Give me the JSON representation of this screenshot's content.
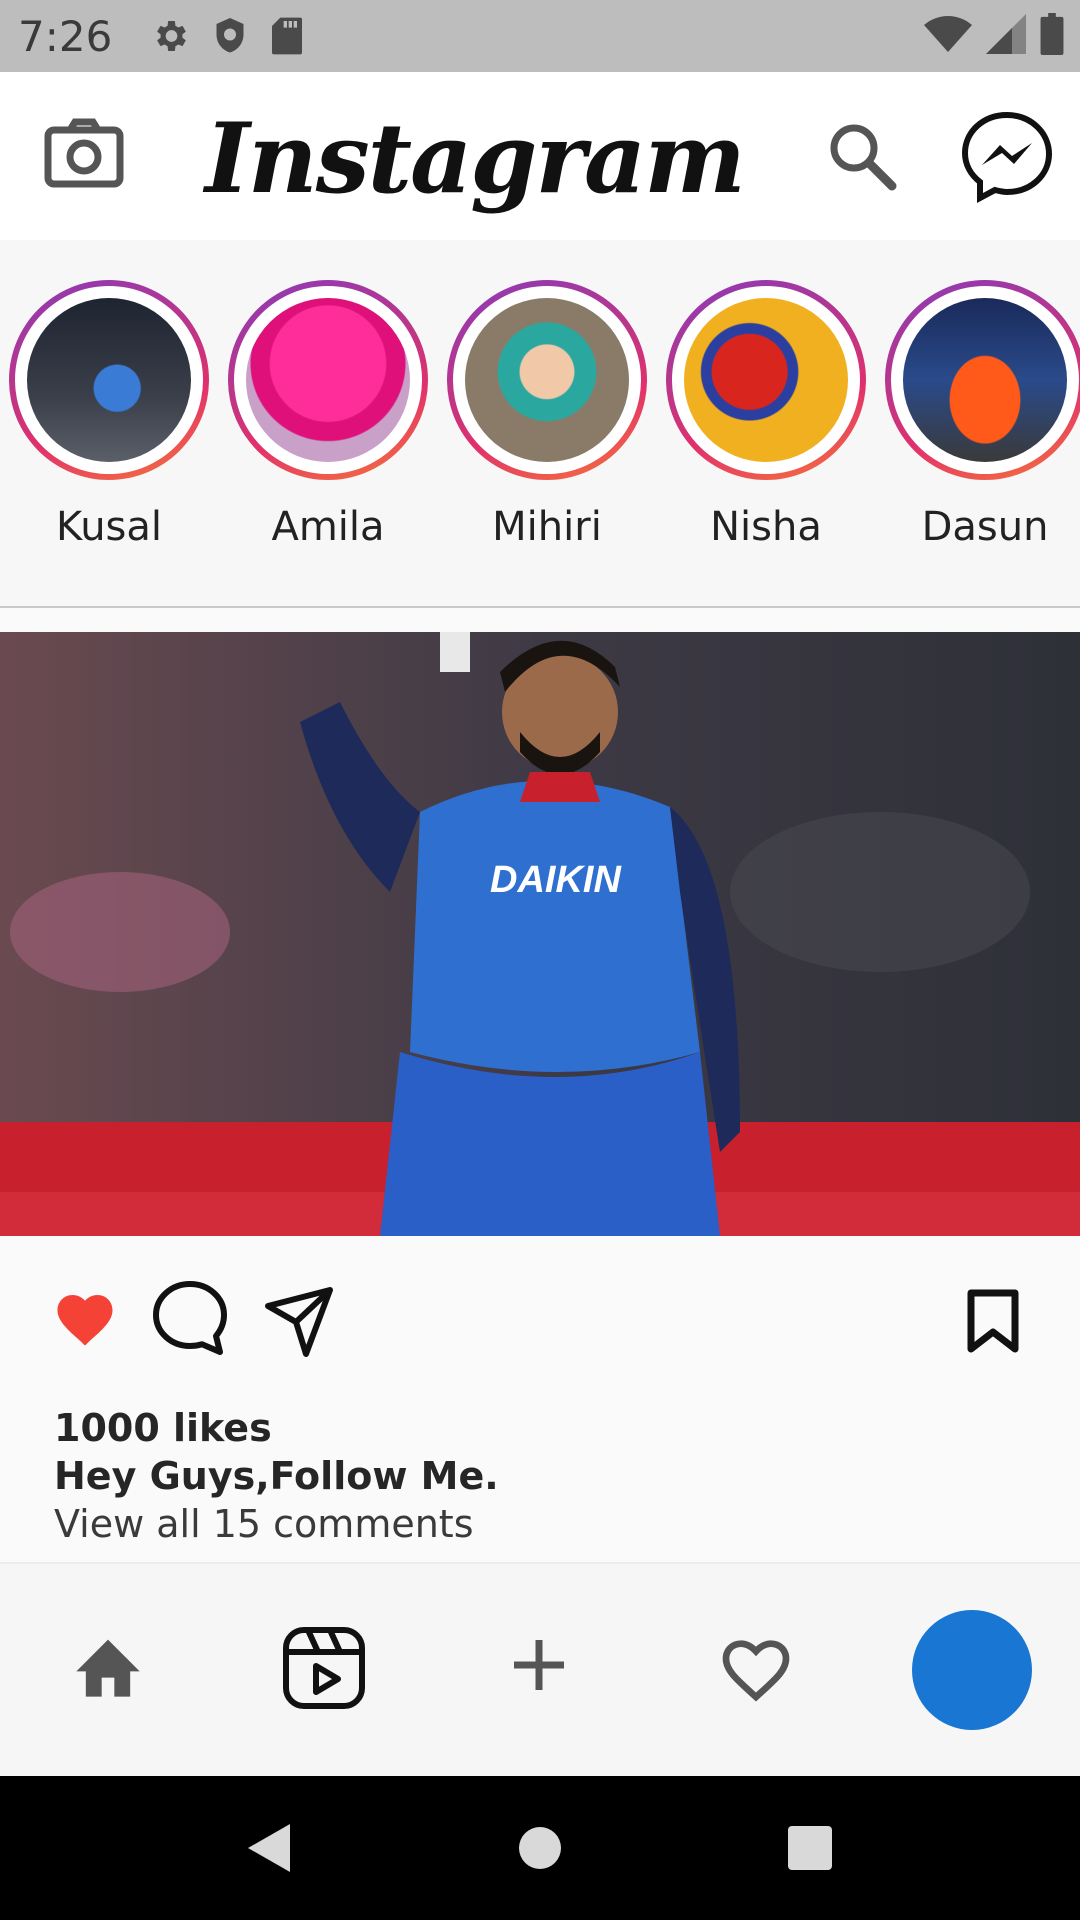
{
  "status_bar": {
    "time": "7:26",
    "icons": [
      "settings-icon",
      "shield-icon",
      "sd-card-icon",
      "wifi-icon",
      "signal-icon",
      "battery-icon"
    ]
  },
  "header": {
    "app_title": "Instagram",
    "icons": [
      "camera-icon",
      "search-icon",
      "messenger-icon"
    ]
  },
  "stories": [
    {
      "name": "Kusal"
    },
    {
      "name": "Amila"
    },
    {
      "name": "Mihiri"
    },
    {
      "name": "Nisha"
    },
    {
      "name": "Dasun"
    }
  ],
  "post": {
    "likes": "1000 likes",
    "caption": "Hey Guys,Follow Me.",
    "comments_link": "View all 15 comments",
    "actions": [
      "like-icon",
      "comment-icon",
      "share-icon",
      "bookmark-icon"
    ],
    "liked": true,
    "colors": {
      "like": "#f44336"
    }
  },
  "bottom_nav": {
    "items": [
      "home-icon",
      "reels-icon",
      "add-icon",
      "activity-icon",
      "profile-avatar"
    ],
    "colors": {
      "profile": "#1976d2"
    }
  },
  "system_nav": [
    "back-button",
    "home-button",
    "recents-button"
  ]
}
